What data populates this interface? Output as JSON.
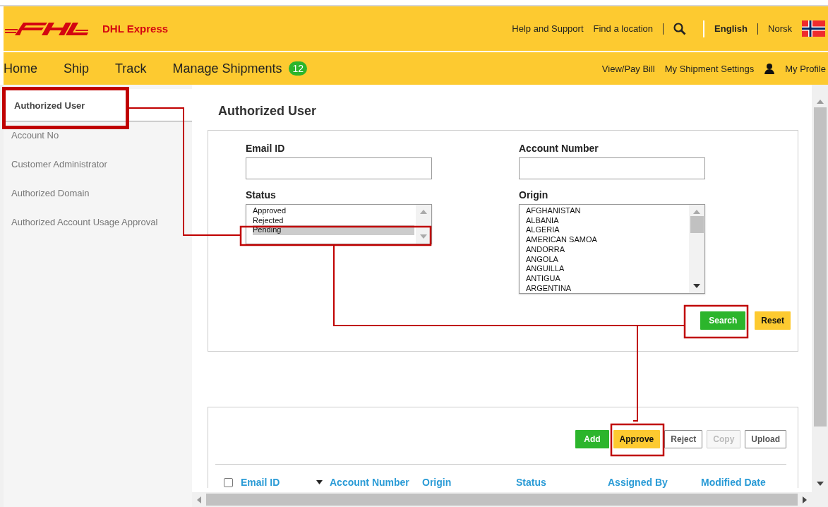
{
  "header": {
    "brand": "DHL Express",
    "links": [
      "Help and Support",
      "Find a location"
    ],
    "languages": [
      {
        "label": "English",
        "selected": true
      },
      {
        "label": "Norsk",
        "selected": false
      }
    ]
  },
  "nav": {
    "items": [
      {
        "label": "Home"
      },
      {
        "label": "Ship"
      },
      {
        "label": "Track"
      },
      {
        "label": "Manage Shipments",
        "badge": "12"
      }
    ],
    "right_links": [
      "View/Pay Bill",
      "My Shipment Settings",
      "My Profile"
    ]
  },
  "sidebar": {
    "items": [
      {
        "label": "Authorized User",
        "selected": true
      },
      {
        "label": "Account No",
        "selected": false
      },
      {
        "label": "Customer Administrator",
        "selected": false
      },
      {
        "label": "Authorized Domain",
        "selected": false
      },
      {
        "label": "Authorized Account Usage Approval",
        "selected": false
      }
    ]
  },
  "page_title": "Authorized User",
  "filters": {
    "email": {
      "label": "Email ID"
    },
    "account": {
      "label": "Account Number"
    },
    "status": {
      "label": "Status",
      "options": [
        {
          "label": "Approved",
          "selected": false
        },
        {
          "label": "Rejected",
          "selected": false
        },
        {
          "label": "Pending",
          "selected": true
        }
      ]
    },
    "origin": {
      "label": "Origin",
      "options": [
        {
          "label": "AFGHANISTAN",
          "selected": false
        },
        {
          "label": "ALBANIA",
          "selected": false
        },
        {
          "label": "ALGERIA",
          "selected": false
        },
        {
          "label": "AMERICAN SAMOA",
          "selected": false
        },
        {
          "label": "ANDORRA",
          "selected": false
        },
        {
          "label": "ANGOLA",
          "selected": false
        },
        {
          "label": "ANGUILLA",
          "selected": false
        },
        {
          "label": "ANTIGUA",
          "selected": false
        },
        {
          "label": "ARGENTINA",
          "selected": false
        }
      ]
    },
    "buttons": [
      {
        "label": "Search",
        "kind": "green"
      },
      {
        "label": "Reset",
        "kind": "yellow"
      }
    ]
  },
  "results": {
    "buttons": [
      {
        "label": "Add",
        "kind": "green",
        "disabled": false
      },
      {
        "label": "Approve",
        "kind": "yellow",
        "disabled": false
      },
      {
        "label": "Reject",
        "kind": "outline",
        "disabled": false
      },
      {
        "label": "Copy",
        "kind": "outline",
        "disabled": true
      },
      {
        "label": "Upload",
        "kind": "outline",
        "disabled": false
      }
    ],
    "select_all": {
      "checked": false
    },
    "columns": [
      {
        "label": "Email ID",
        "sortable": true
      },
      {
        "label": "Account Number",
        "sortable": false
      },
      {
        "label": "Origin",
        "sortable": false
      },
      {
        "label": "Status",
        "sortable": false
      },
      {
        "label": "Assigned By",
        "sortable": false
      },
      {
        "label": "Modified Date",
        "sortable": false
      }
    ]
  }
}
